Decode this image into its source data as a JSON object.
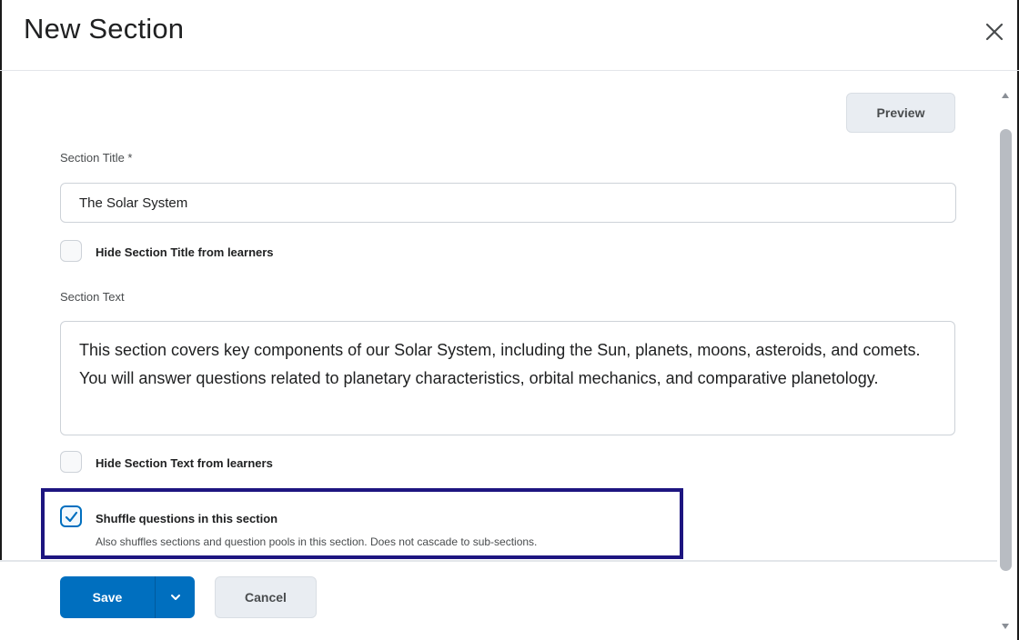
{
  "dialog": {
    "title": "New Section",
    "close_icon": "close-icon"
  },
  "toolbar": {
    "preview_label": "Preview"
  },
  "form": {
    "section_title_label": "Section Title *",
    "section_title_value": "The Solar System",
    "hide_title_label": "Hide Section Title from learners",
    "hide_title_checked": false,
    "section_text_label": "Section Text",
    "section_text_value": "This section covers key components of our Solar System, including the Sun, planets, moons, asteroids, and comets. You will answer questions related to planetary characteristics, orbital mechanics, and comparative planetology.",
    "hide_text_label": "Hide Section Text from learners",
    "hide_text_checked": false,
    "shuffle_label": "Shuffle questions in this section",
    "shuffle_checked": true,
    "shuffle_description": "Also shuffles sections and question pools in this section. Does not cascade to sub-sections."
  },
  "footer": {
    "save_label": "Save",
    "save_menu_icon": "chevron-down-icon",
    "cancel_label": "Cancel"
  },
  "colors": {
    "primary": "#006fbf",
    "highlight_border": "#1d1580",
    "secondary_button": "#e9edf2"
  }
}
